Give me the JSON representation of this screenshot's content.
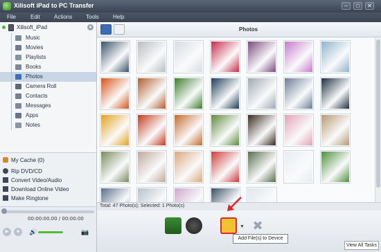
{
  "window": {
    "title": "Xilisoft iPad to PC Transfer",
    "controls": [
      "minimize",
      "maximize",
      "close"
    ]
  },
  "menu": [
    "File",
    "Edit",
    "Actions",
    "Tools",
    "Help"
  ],
  "sidebar": {
    "device": "Xilisoft_iPad",
    "items": [
      {
        "label": "Music",
        "icon": "music-icon"
      },
      {
        "label": "Movies",
        "icon": "movies-icon"
      },
      {
        "label": "Playlists",
        "icon": "playlists-icon"
      },
      {
        "label": "Books",
        "icon": "books-icon"
      },
      {
        "label": "Photos",
        "icon": "photos-icon",
        "selected": true
      },
      {
        "label": "Camera Roll",
        "icon": "camera-roll-icon"
      },
      {
        "label": "Contacts",
        "icon": "contacts-icon"
      },
      {
        "label": "Messages",
        "icon": "messages-icon"
      },
      {
        "label": "Apps",
        "icon": "apps-icon"
      },
      {
        "label": "Notes",
        "icon": "notes-icon"
      }
    ]
  },
  "lower": {
    "cache": "My Cache (0)",
    "tasks": [
      {
        "label": "Rip DVD/CD",
        "icon": "disc-icon"
      },
      {
        "label": "Convert Video/Audio",
        "icon": "convert-icon"
      },
      {
        "label": "Download Online Video",
        "icon": "download-icon"
      },
      {
        "label": "Make Ringtone",
        "icon": "ringtone-icon"
      }
    ]
  },
  "player": {
    "time": "00:00:00.00 / 00:00:00",
    "volume_level": 0.8
  },
  "main": {
    "header_title": "Photos",
    "status": "Total: 47 Photo(s); Selected: 1 Photo(s)",
    "tooltip": "Add File(s) to Device",
    "view_all": "View All Tasks",
    "thumb_colors": [
      "#3a5266",
      "#b9bcc2",
      "#d8dde3",
      "#c92a4a",
      "#7a4a7d",
      "#c77ac9",
      "#8fb3cc",
      "#d75318",
      "#b35d2e",
      "#3d7d2a",
      "#1d3c56",
      "#9fa8b2",
      "#6b7d95",
      "#1f2f40",
      "#e2a21a",
      "#c43a1a",
      "#c56b2c",
      "#5e8a3a",
      "#3a2a1f",
      "#e1a3b5",
      "#b69a72",
      "#7a8a5a",
      "#c0a89a",
      "#d9a87a",
      "#cf3a3a",
      "#586e4a",
      "#e7ecf2",
      "#4e8f3c",
      "#5a6f8a",
      "#b6c0ca",
      "#cfa7c9",
      "#3a4e66",
      "#e1e5ea"
    ]
  }
}
